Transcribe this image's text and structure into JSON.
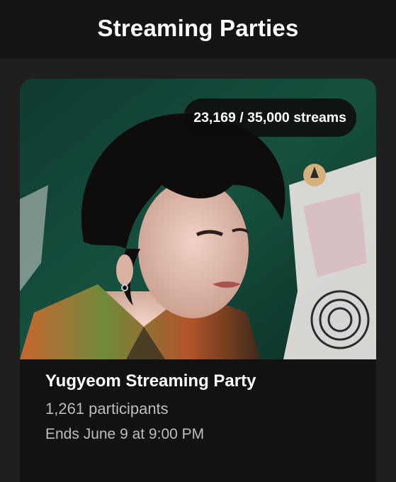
{
  "header": {
    "title": "Streaming Parties"
  },
  "party": {
    "progress_text": "23,169 / 35,000 streams",
    "streams_current": 23169,
    "streams_goal": 35000,
    "title": "Yugyeom Streaming Party",
    "participants": "1,261 participants",
    "ends": "Ends June 9 at 9:00 PM"
  },
  "colors": {
    "header_bg": "#141414",
    "page_bg": "#1f1f1f",
    "card_bg": "#121212",
    "cover_bg": "#12463a"
  }
}
